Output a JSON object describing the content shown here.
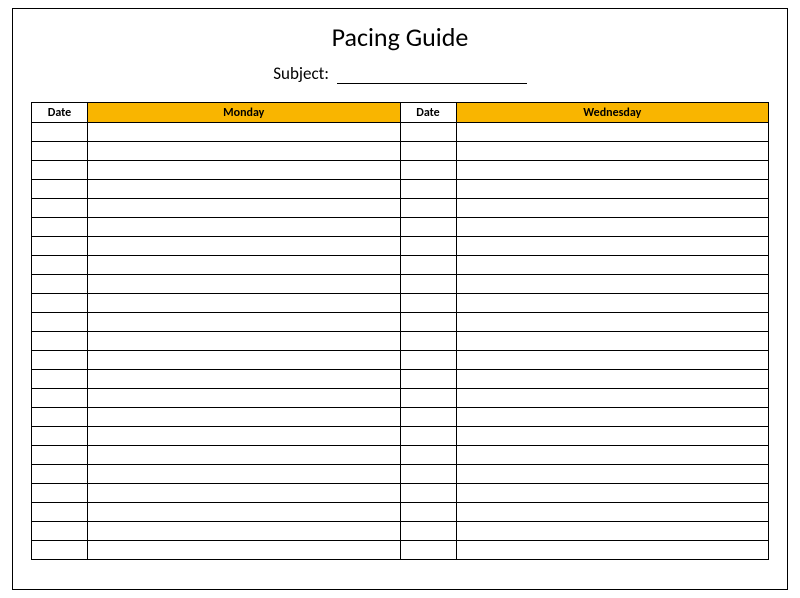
{
  "title": "Pacing Guide",
  "subject_label": "Subject:",
  "headers": {
    "date": "Date",
    "day1": "Monday",
    "day2": "Wednesday"
  },
  "row_count": 23,
  "accent_color": "#f9b500"
}
